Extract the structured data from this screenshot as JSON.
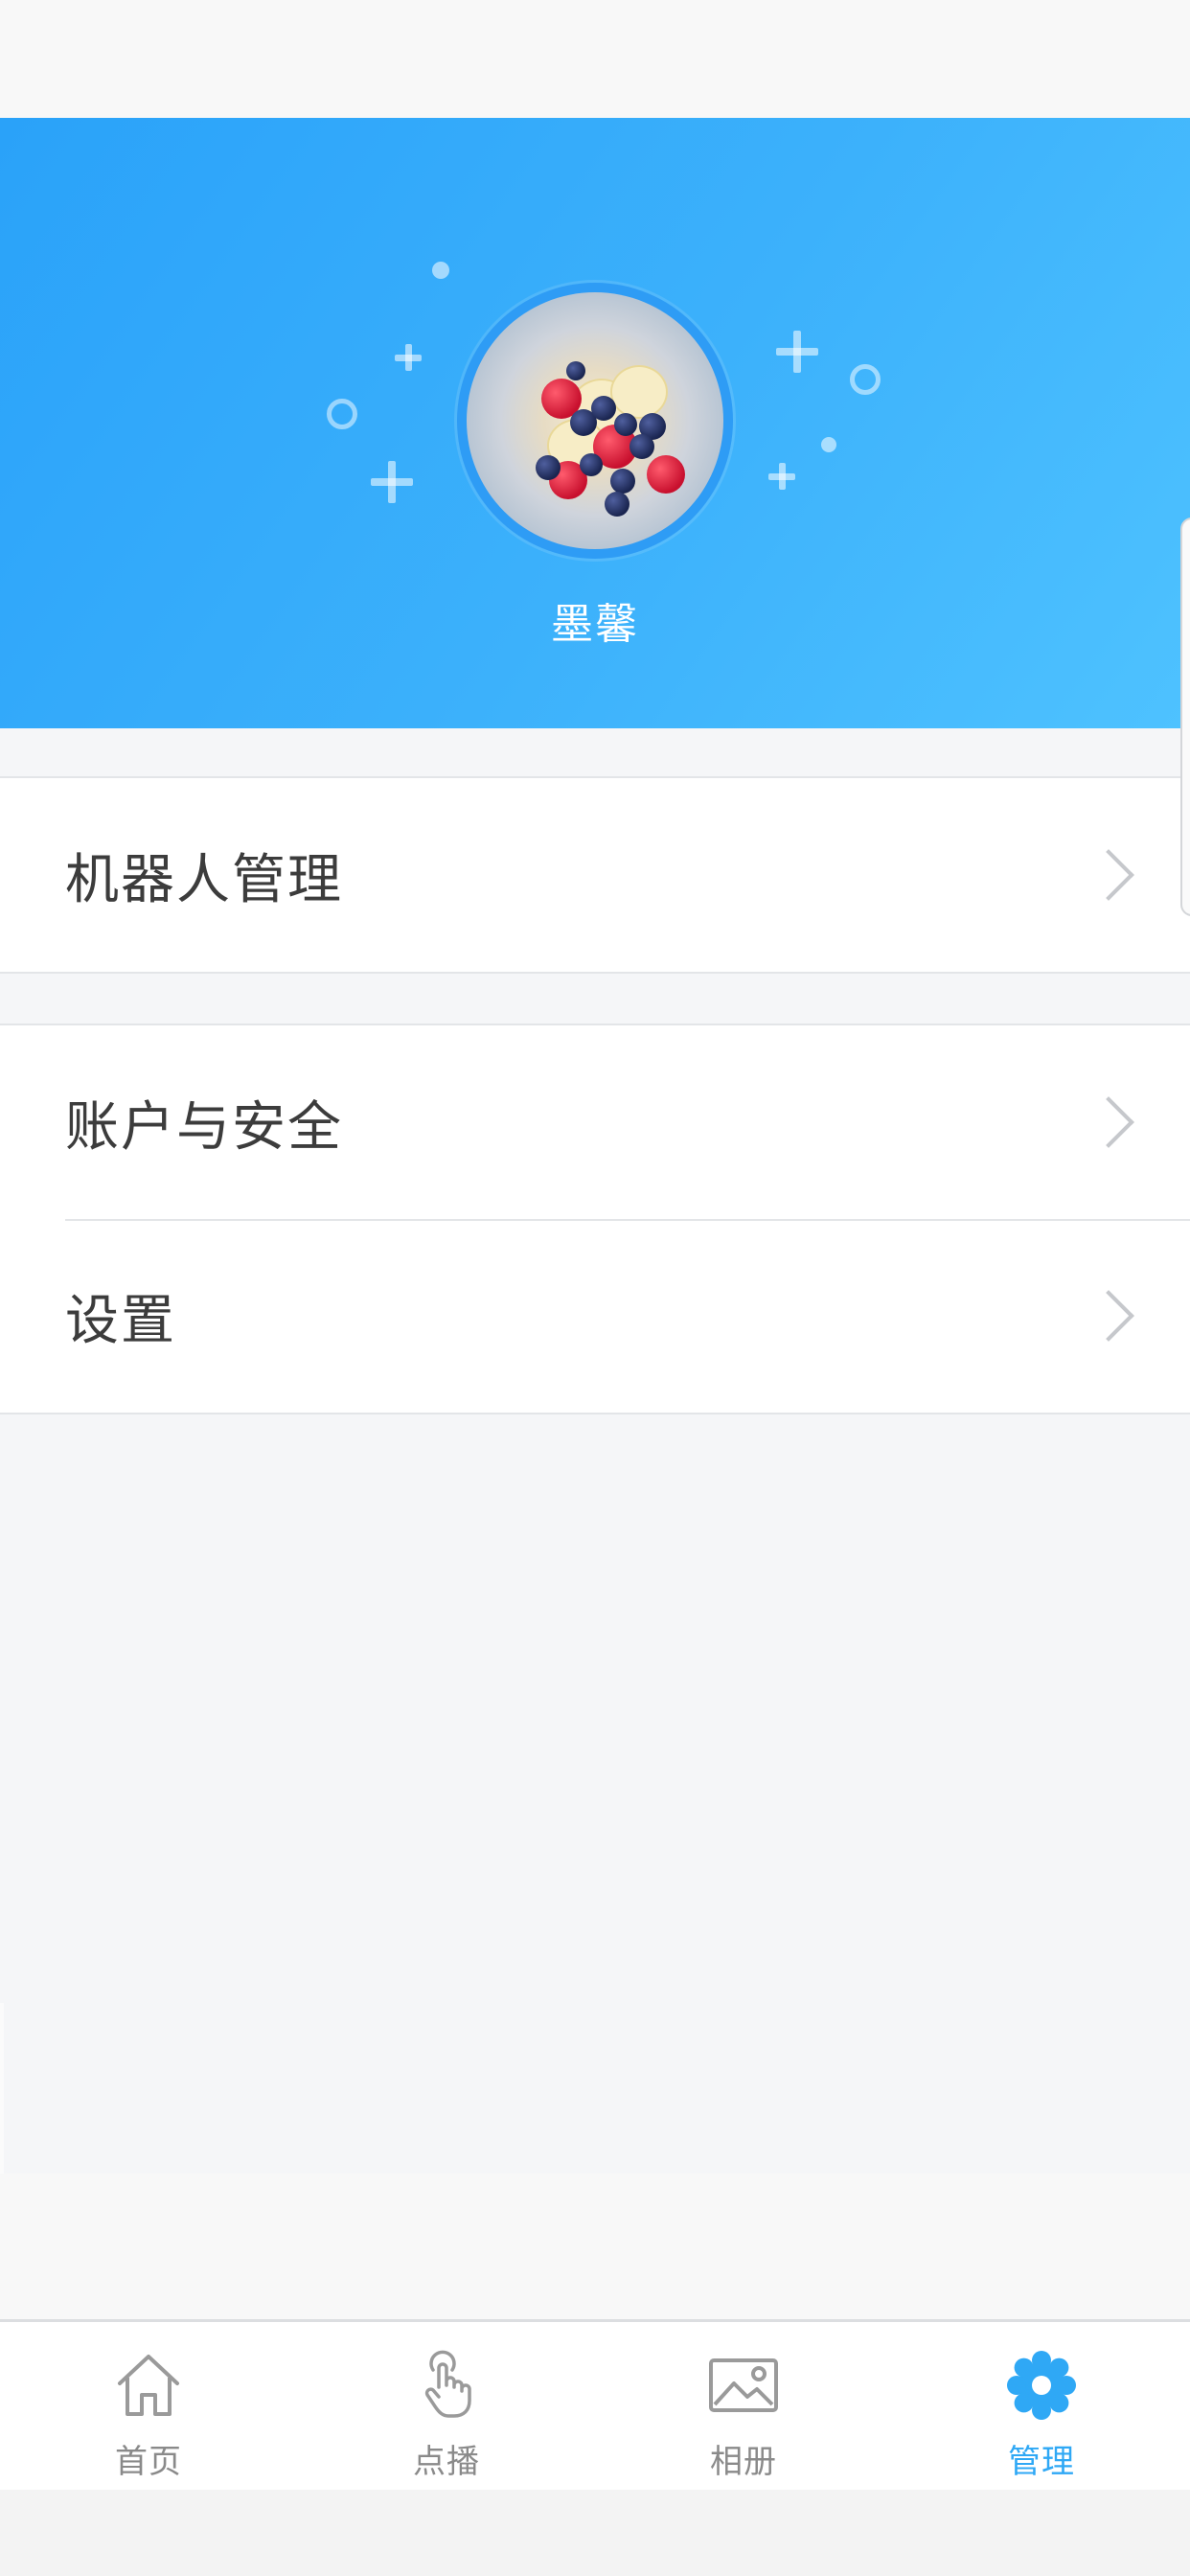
{
  "profile": {
    "name": "墨馨"
  },
  "menu": {
    "group1": [
      {
        "label": "机器人管理"
      }
    ],
    "group2": [
      {
        "label": "账户与安全"
      },
      {
        "label": "设置"
      }
    ]
  },
  "tabbar": {
    "items": [
      {
        "label": "首页",
        "icon": "home-icon",
        "active": false
      },
      {
        "label": "点播",
        "icon": "tap-hand-icon",
        "active": false
      },
      {
        "label": "相册",
        "icon": "image-icon",
        "active": false
      },
      {
        "label": "管理",
        "icon": "gear-icon",
        "active": true
      }
    ]
  },
  "colors": {
    "header_gradient_start": "#2aa2f9",
    "header_gradient_end": "#4ec2ff",
    "accent": "#2fa8f5",
    "inactive_tab": "#8a8a8a",
    "page_background": "#f5f6f8"
  }
}
